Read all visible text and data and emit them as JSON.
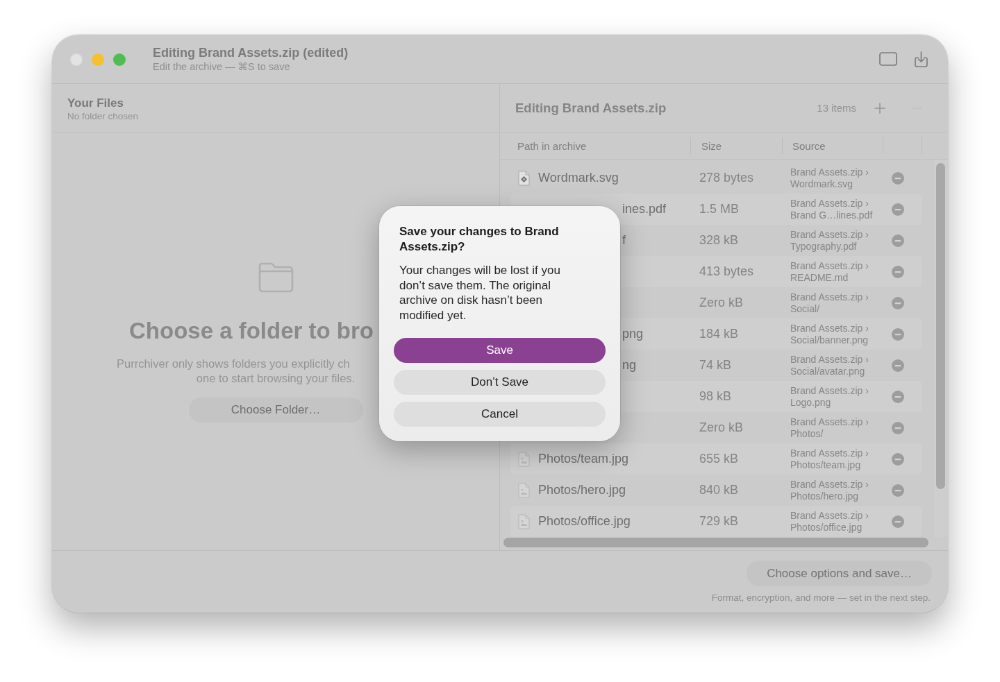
{
  "window": {
    "title": "Editing Brand Assets.zip (edited)",
    "subtitle": "Edit the archive — ⌘S to save",
    "controls": [
      {
        "kind": "close",
        "disabled": true
      },
      {
        "kind": "minimize",
        "disabled": false
      },
      {
        "kind": "zoom",
        "disabled": false
      }
    ]
  },
  "files_pane": {
    "title": "Your Files",
    "subtitle": "No folder chosen",
    "empty_state": {
      "heading": "Choose a folder to bro",
      "description_lines": [
        "Purrchiver only shows folders you explicitly ch",
        "one to start browsing your files."
      ],
      "button": "Choose Folder…"
    }
  },
  "archive_pane": {
    "title": "Editing Brand Assets.zip",
    "count": "13 items",
    "actions": [
      {
        "kind": "add",
        "disabled": false
      },
      {
        "kind": "remove",
        "disabled": true
      }
    ],
    "table": {
      "columns": [
        "Path in archive",
        "Size",
        "Source"
      ],
      "rows": [
        {
          "kind": "vector",
          "path": "Wordmark.svg",
          "size": "278 bytes",
          "source": "Brand Assets.zip › Wordmark.svg"
        },
        {
          "kind": "clipped",
          "path": "ines.pdf",
          "size": "1.5 MB",
          "source": "Brand Assets.zip › Brand G…lines.pdf"
        },
        {
          "kind": "clipped",
          "path": "f",
          "size": "328 kB",
          "source": "Brand Assets.zip › Typography.pdf"
        },
        {
          "kind": "clipped",
          "size": "413 bytes",
          "source": "Brand Assets.zip › README.md"
        },
        {
          "kind": "clipped",
          "size": "Zero kB",
          "source": "Brand Assets.zip › Social/"
        },
        {
          "kind": "clipped",
          "path": "png",
          "size": "184 kB",
          "source": "Brand Assets.zip › Social/banner.png"
        },
        {
          "kind": "clipped",
          "path": "ng",
          "size": "74 kB",
          "source": "Brand Assets.zip › Social/avatar.png"
        },
        {
          "kind": "clipped",
          "size": "98 kB",
          "source": "Brand Assets.zip › Logo.png"
        },
        {
          "kind": "clipped",
          "size": "Zero kB",
          "source": "Brand Assets.zip › Photos/"
        },
        {
          "kind": "image",
          "path": "Photos/team.jpg",
          "size": "655 kB",
          "source": "Brand Assets.zip › Photos/team.jpg"
        },
        {
          "kind": "image",
          "path": "Photos/hero.jpg",
          "size": "840 kB",
          "source": "Brand Assets.zip › Photos/hero.jpg"
        },
        {
          "kind": "image",
          "path": "Photos/office.jpg",
          "size": "729 kB",
          "source": "Brand Assets.zip › Photos/office.jpg"
        }
      ]
    }
  },
  "footer": {
    "button": "Choose options and save…",
    "caption": "Format, encryption, and more — set in the next step."
  },
  "dialog": {
    "title": "Save your changes to Brand Assets.zip?",
    "message": "Your changes will be lost if you don’t save them. The original archive on disk hasn’t been modified yet.",
    "buttons": [
      {
        "label": "Save",
        "kind": "primary"
      },
      {
        "label": "Don’t Save",
        "kind": "secondary"
      },
      {
        "label": "Cancel",
        "kind": "secondary"
      }
    ]
  }
}
